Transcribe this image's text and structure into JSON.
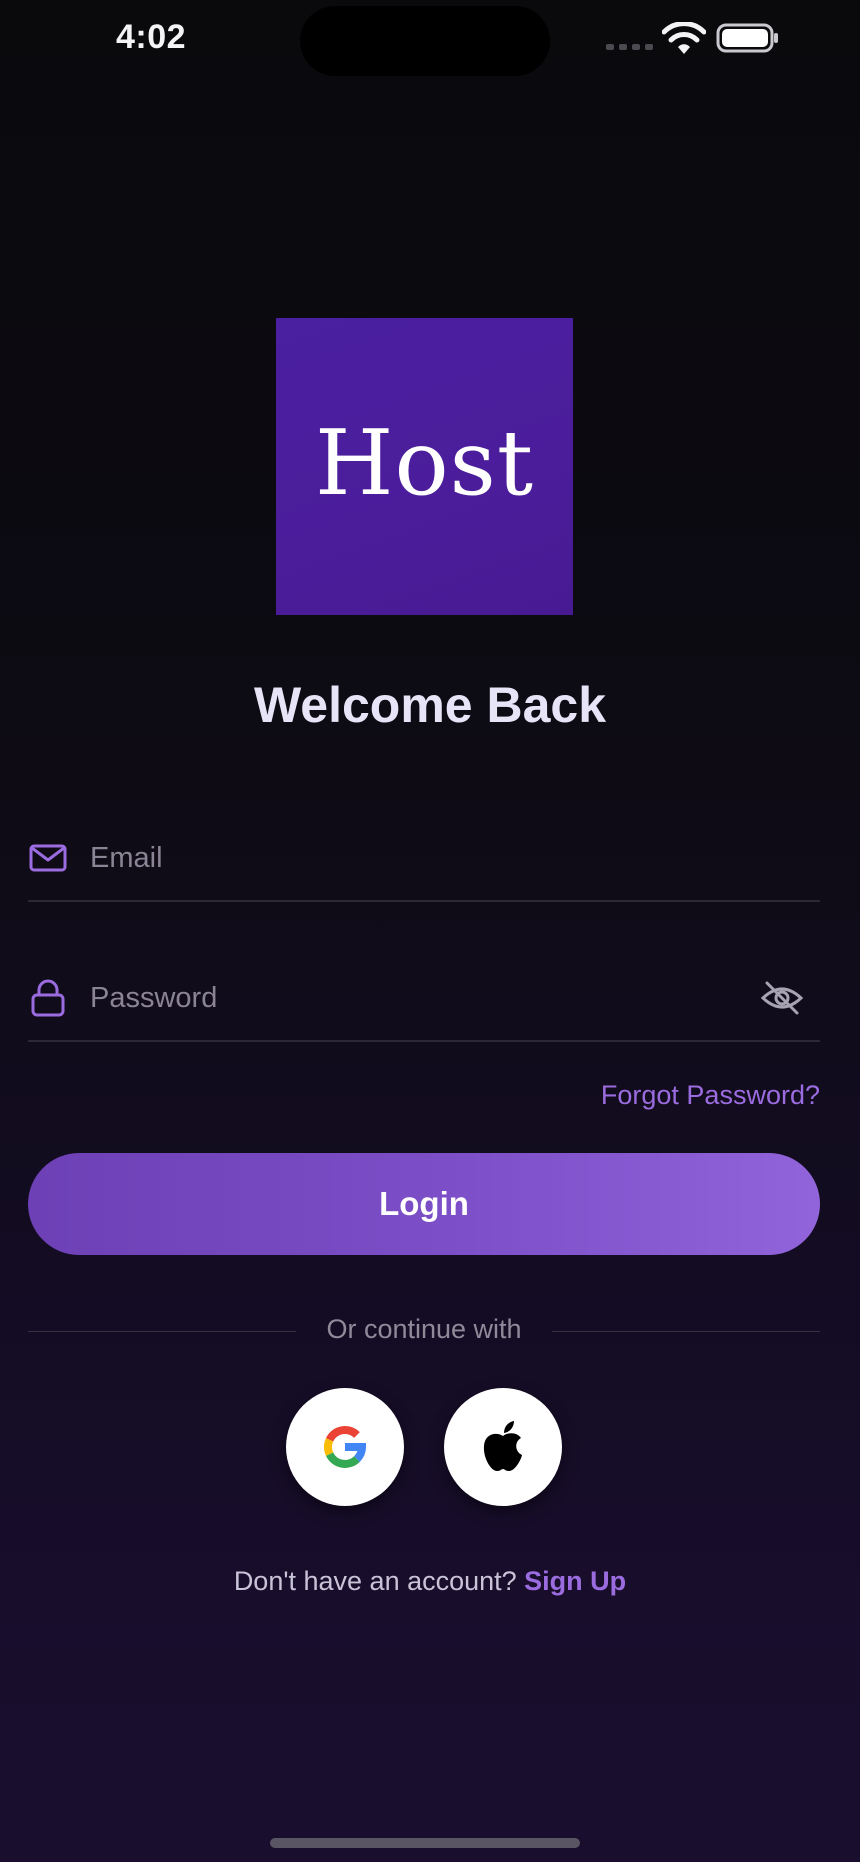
{
  "status_bar": {
    "time": "4:02",
    "signal_icon": "cellular-signal-icon",
    "wifi_icon": "wifi-icon",
    "battery_icon": "battery-icon"
  },
  "logo": {
    "text": "Host",
    "background_color": "#4a1fa0"
  },
  "title": "Welcome Back",
  "form": {
    "email": {
      "placeholder": "Email",
      "value": "",
      "icon": "mail-icon"
    },
    "password": {
      "placeholder": "Password",
      "value": "",
      "icon": "lock-icon",
      "toggle_icon": "eye-slash-icon"
    },
    "forgot_label": "Forgot Password?",
    "login_label": "Login"
  },
  "social": {
    "divider_label": "Or continue with",
    "providers": [
      {
        "name": "google",
        "icon": "google-logo-icon"
      },
      {
        "name": "apple",
        "icon": "apple-logo-icon"
      }
    ]
  },
  "signup": {
    "prompt": "Don't have an account?",
    "link": "Sign Up"
  },
  "colors": {
    "accent": "#9b6cdf",
    "button_gradient_start": "#6d40b6",
    "button_gradient_end": "#9264db",
    "background_top": "#0a090c",
    "background_bottom": "#1a0e2f"
  }
}
